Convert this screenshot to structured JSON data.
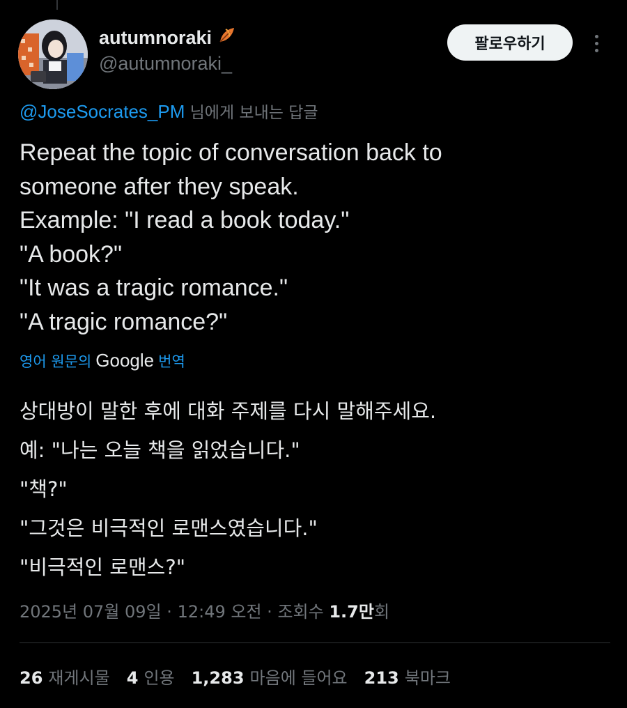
{
  "author": {
    "name": "autumnoraki",
    "handle": "@autumnoraki_",
    "badge_icon": "autumn-leaf-icon"
  },
  "follow_button": {
    "label": "팔로우하기"
  },
  "more_button": {
    "icon": "more-options-icon"
  },
  "reply_context": {
    "mention": "@JoseSocrates_PM",
    "suffix": "님에게 보내는 답글"
  },
  "tweet": {
    "lines": [
      "Repeat the topic of conversation back to",
      "someone after they speak.",
      "Example: \"I read a book today.\"",
      "\"A book?\"",
      "\"It was a tragic romance.\"",
      "\"A tragic romance?\""
    ]
  },
  "translation": {
    "link_prefix": "영어 원문의",
    "link_brand": "Google",
    "link_suffix": "번역",
    "lines": [
      "상대방이 말한 후에 대화 주제를 다시 말해주세요.",
      "예: \"나는 오늘 책을 읽었습니다.\"",
      "\"책?\"",
      "\"그것은 비극적인 로맨스였습니다.\"",
      "\"비극적인 로맨스?\""
    ]
  },
  "meta": {
    "date": "2025년 07월 09일",
    "time": "12:49 오전",
    "views_label": "조회수",
    "views_count": "1.7만",
    "views_unit": "회",
    "separator": "·"
  },
  "stats": {
    "retweets": {
      "count": "26",
      "label": "재게시물"
    },
    "quotes": {
      "count": "4",
      "label": "인용"
    },
    "likes": {
      "count": "1,283",
      "label": "마음에 들어요"
    },
    "bookmarks": {
      "count": "213",
      "label": "북마크"
    }
  },
  "colors": {
    "background": "#000000",
    "text_primary": "#e7e9ea",
    "text_secondary": "#71767b",
    "link": "#1d9bf0",
    "follow_bg": "#eff3f4",
    "leaf": "#e8772e"
  }
}
